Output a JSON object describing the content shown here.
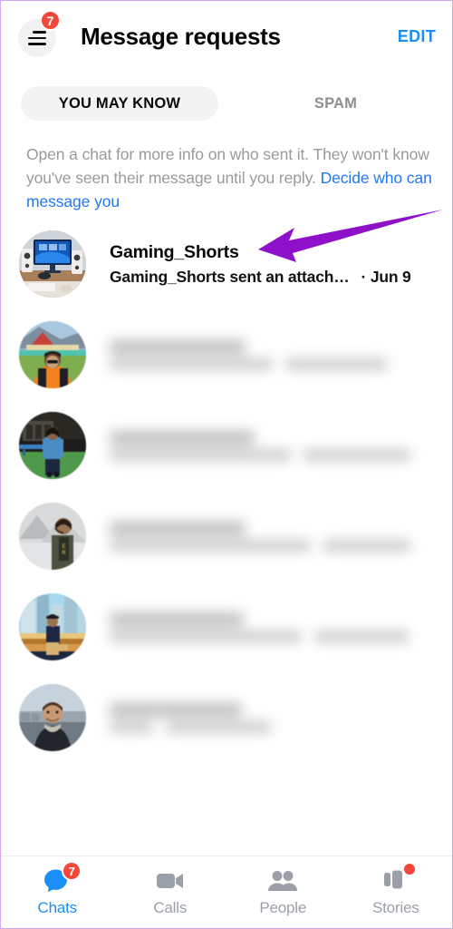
{
  "header": {
    "title": "Message requests",
    "edit_label": "EDIT",
    "menu_badge_count": "7",
    "menu_icon": "hamburger-menu-icon",
    "edit_color": "#1b8ef8"
  },
  "tabs": [
    {
      "label": "YOU MAY KNOW",
      "active": true
    },
    {
      "label": "SPAM",
      "active": false
    }
  ],
  "info": {
    "text": "Open a chat for more info on who sent it. They won't know you've seen their message until you reply. ",
    "link_label": "Decide who can message you",
    "link_color": "#2477f2"
  },
  "annotation": {
    "type": "arrow",
    "color": "#8e10c9",
    "points_to": "Gaming_Shorts"
  },
  "conversations": [
    {
      "name": "Gaming_Shorts",
      "preview": "Gaming_Shorts sent an attach…",
      "separator": "·",
      "time": "Jun 9",
      "redacted": false,
      "avatar": "gaming-desk-setup-photo"
    },
    {
      "name": "",
      "preview": "",
      "time": "",
      "redacted": true,
      "avatar": "person-orange-jacket-photo"
    },
    {
      "name": "",
      "preview": "",
      "time": "",
      "redacted": true,
      "avatar": "person-blue-jacket-photo"
    },
    {
      "name": "",
      "preview": "",
      "time": "",
      "redacted": true,
      "avatar": "person-mountain-photo"
    },
    {
      "name": "",
      "preview": "",
      "time": "",
      "redacted": true,
      "avatar": "person-city-window-photo"
    },
    {
      "name": "",
      "preview": "",
      "time": "",
      "redacted": true,
      "avatar": "person-portrait-photo"
    }
  ],
  "bottom_nav": [
    {
      "label": "Chats",
      "icon": "chat-bubble-icon",
      "active": true,
      "badge": "7",
      "dot": false
    },
    {
      "label": "Calls",
      "icon": "video-camera-icon",
      "active": false,
      "badge": null,
      "dot": false
    },
    {
      "label": "People",
      "icon": "people-icon",
      "active": false,
      "badge": null,
      "dot": false
    },
    {
      "label": "Stories",
      "icon": "stories-cards-icon",
      "active": false,
      "badge": null,
      "dot": true
    }
  ],
  "colors": {
    "accent_blue": "#1b8ef8",
    "badge_red": "#f5463b",
    "annotation_purple": "#8e10c9",
    "muted_gray": "#9ba0a8"
  }
}
